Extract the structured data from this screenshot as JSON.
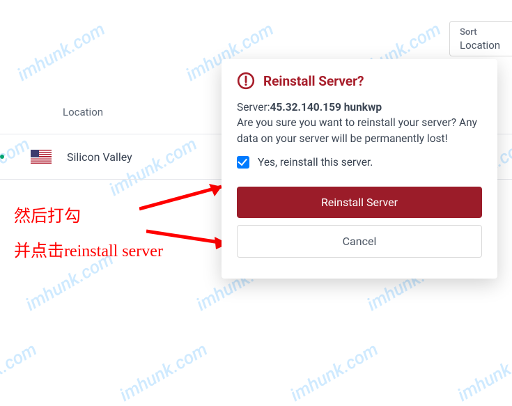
{
  "watermark_text": "imhunk.com",
  "sort": {
    "label": "Sort",
    "value": "Location"
  },
  "table": {
    "header_location": "Location",
    "row": {
      "location_name": "Silicon Valley"
    }
  },
  "annotations": {
    "line1": "然后打勾",
    "line2": "并点击reinstall server"
  },
  "modal": {
    "title": "Reinstall Server?",
    "server_label": "Server:",
    "server_value": "45.32.140.159 hunkwp",
    "confirm_text": "Are you sure you want to reinstall your server? Any data on your server will be permanently lost!",
    "checkbox_label": "Yes, reinstall this server.",
    "primary_button": "Reinstall Server",
    "secondary_button": "Cancel"
  }
}
